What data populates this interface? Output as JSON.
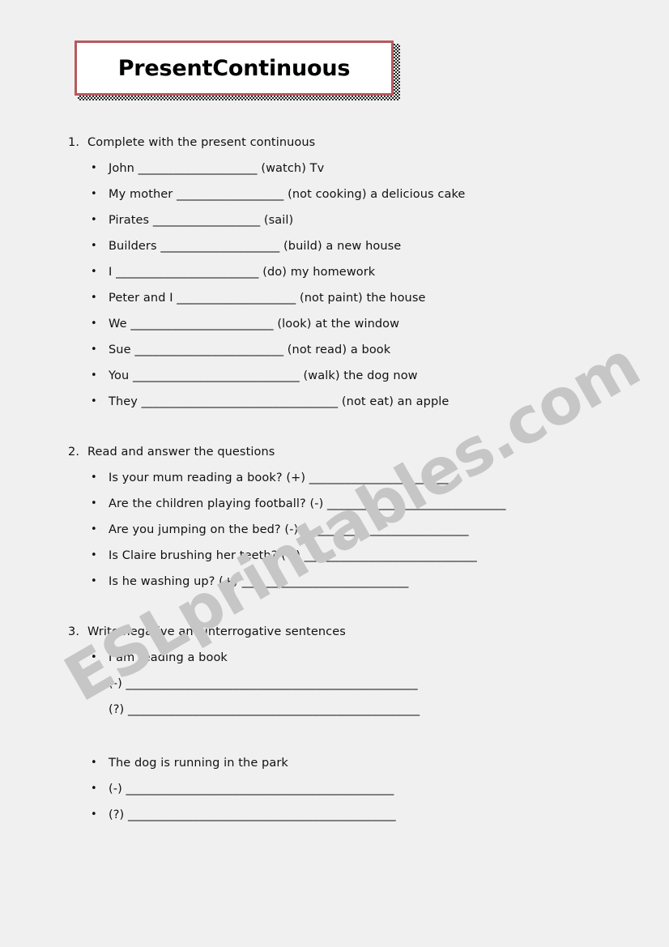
{
  "page": {
    "background_color": "#f0f0f0",
    "title": "PresentContinuous",
    "title_box_border_color": "#b5595f",
    "title_box_background": "#ffffff"
  },
  "watermark": {
    "text": "ESLprintables.com",
    "color": "#c6c6c6",
    "rotation_deg": -30
  },
  "bullet_glyph": "•",
  "sections": [
    {
      "number": "1.",
      "title": "Complete with the present continuous",
      "items": [
        {
          "bullet": true,
          "text": "John ____________________ (watch) Tv"
        },
        {
          "bullet": true,
          "text": "My mother __________________ (not cooking) a delicious cake"
        },
        {
          "bullet": true,
          "text": "Pirates __________________ (sail)"
        },
        {
          "bullet": true,
          "text": "Builders ____________________ (build) a new house"
        },
        {
          "bullet": true,
          "text": "I ________________________ (do) my homework"
        },
        {
          "bullet": true,
          "text": "Peter and I ____________________ (not paint) the house"
        },
        {
          "bullet": true,
          "text": "We ________________________ (look) at the window"
        },
        {
          "bullet": true,
          "text": "Sue _________________________ (not read) a book"
        },
        {
          "bullet": true,
          "text": "You ____________________________ (walk) the dog now"
        },
        {
          "bullet": true,
          "text": "They _________________________________ (not eat) an apple"
        }
      ]
    },
    {
      "number": "2.",
      "title": "Read and answer the questions",
      "items": [
        {
          "bullet": true,
          "text": "Is your mum reading a book? (+) _________________________"
        },
        {
          "bullet": true,
          "text": "Are the children playing football? (-) ______________________________"
        },
        {
          "bullet": true,
          "text": "Are you jumping on the bed? (-) ____________________________"
        },
        {
          "bullet": true,
          "text": "Is Claire brushing her teeth? (+) _____________________________"
        },
        {
          "bullet": true,
          "text": "Is he washing up? (+) ____________________________"
        }
      ]
    },
    {
      "number": "3.",
      "title": "Write negative and interrogative sentences",
      "items": [
        {
          "bullet": true,
          "text": "I am reading a book"
        },
        {
          "bullet": false,
          "text": "(-) _________________________________________________"
        },
        {
          "bullet": false,
          "text": "(?) _________________________________________________"
        },
        {
          "bullet": true,
          "text": "The dog is running in the park",
          "gap_before": "large"
        },
        {
          "bullet": true,
          "text": "(-) _____________________________________________"
        },
        {
          "bullet": true,
          "text": "(?) _____________________________________________"
        }
      ]
    }
  ]
}
